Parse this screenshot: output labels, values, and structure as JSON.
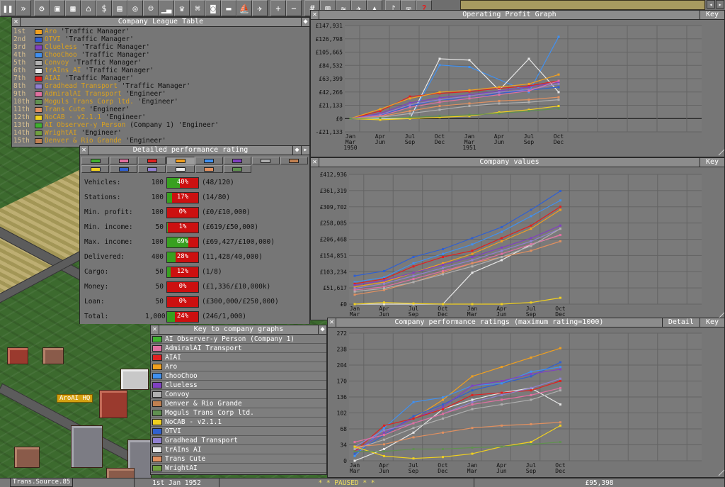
{
  "toolbar": {
    "icons": [
      "pause-icon",
      "fast-forward-icon",
      "settings-wrench-icon",
      "save-disk-icon",
      "map-icon",
      "town-directory-icon",
      "subsidies-icon",
      "stations-icon",
      "finances-coins-icon",
      "company-manager-icon",
      "graphs-icon",
      "league-trophy-icon",
      "industries-icon",
      "trains-icon",
      "road-vehicles-icon",
      "ships-icon",
      "aircraft-icon",
      "zoom-in-icon",
      "zoom-out-icon",
      "build-rail-icon",
      "build-road-icon",
      "build-docks-icon",
      "build-airport-icon",
      "landscaping-icon",
      "music-icon",
      "messages-icon",
      "help-question-icon"
    ]
  },
  "league": {
    "title": "Company League Table",
    "rows": [
      {
        "pos": "1st",
        "name": "Aro",
        "title": "'Traffic Manager'",
        "color": "#f0a020"
      },
      {
        "pos": "2nd",
        "name": "OTVI",
        "title": "'Traffic Manager'",
        "color": "#3060d0"
      },
      {
        "pos": "3rd",
        "name": "Clueless",
        "title": "'Traffic Manager'",
        "color": "#8040c0"
      },
      {
        "pos": "4th",
        "name": "ChooChoo",
        "title": "'Traffic Manager'",
        "color": "#4090f0"
      },
      {
        "pos": "5th",
        "name": "Convoy",
        "title": "'Traffic Manager'",
        "color": "#b0b0b0"
      },
      {
        "pos": "6th",
        "name": "trAIns AI",
        "title": "'Traffic Manager'",
        "color": "#e8e8e8"
      },
      {
        "pos": "7th",
        "name": "AIAI",
        "title": "'Traffic Manager'",
        "color": "#e02020"
      },
      {
        "pos": "8th",
        "name": "Gradhead Transport",
        "title": "'Traffic Manager'",
        "color": "#9080d0"
      },
      {
        "pos": "9th",
        "name": "AdmiralAI Transport",
        "title": "'Engineer'",
        "color": "#e070a0"
      },
      {
        "pos": "10th",
        "name": "Moguls Trans Corp ltd.",
        "title": "'Engineer'",
        "color": "#609050"
      },
      {
        "pos": "11th",
        "name": "Trans Cute",
        "title": "'Engineer'",
        "color": "#e09060"
      },
      {
        "pos": "12th",
        "name": "NoCAB - v2.1.1",
        "title": "'Engineer'",
        "color": "#f0d020"
      },
      {
        "pos": "13th",
        "name": "AI Observer-y Person",
        "extra": "(Company 1)",
        "title": "'Engineer'",
        "color": "#40b030"
      },
      {
        "pos": "14th",
        "name": "WrightAI",
        "title": "'Engineer'",
        "color": "#70a040"
      },
      {
        "pos": "15th",
        "name": "Denver & Rio Grande",
        "title": "'Engineer'",
        "color": "#c08050"
      }
    ]
  },
  "perf": {
    "title": "Detailed performance rating",
    "swatches": [
      "#40b030",
      "#e070a0",
      "#e02020",
      "#f0a020",
      "#4090f0",
      "#8040c0",
      "#b0b0b0",
      "#c08050",
      "#f0d020",
      "#3060d0",
      "#9080d0",
      "#e8e8e8",
      "#e09060",
      "#609050"
    ],
    "rows": [
      {
        "label": "Vehicles:",
        "max": "100",
        "pct": "40%",
        "frac": 0.4,
        "val": "(48/120)"
      },
      {
        "label": "Stations:",
        "max": "100",
        "pct": "17%",
        "frac": 0.17,
        "val": "(14/80)"
      },
      {
        "label": "Min. profit:",
        "max": "100",
        "pct": "0%",
        "frac": 0,
        "val": "(£0/£10,000)"
      },
      {
        "label": "Min. income:",
        "max": "50",
        "pct": "1%",
        "frac": 0.01,
        "val": "(£619/£50,000)"
      },
      {
        "label": "Max. income:",
        "max": "100",
        "pct": "69%",
        "frac": 0.69,
        "val": "(£69,427/£100,000)"
      },
      {
        "label": "Delivered:",
        "max": "400",
        "pct": "28%",
        "frac": 0.28,
        "val": "(11,428/40,000)"
      },
      {
        "label": "Cargo:",
        "max": "50",
        "pct": "12%",
        "frac": 0.12,
        "val": "(1/8)"
      },
      {
        "label": "Money:",
        "max": "50",
        "pct": "0%",
        "frac": 0,
        "val": "(£1,336/£10,000k)"
      },
      {
        "label": "Loan:",
        "max": "50",
        "pct": "0%",
        "frac": 0,
        "val": "(£300,000/£250,000)"
      },
      {
        "label": "Total:",
        "max": "1,000",
        "pct": "24%",
        "frac": 0.24,
        "val": "(246/1,000)"
      }
    ]
  },
  "key": {
    "title": "Key to company graphs",
    "rows": [
      {
        "name": "AI Observer-y Person (Company 1)",
        "color": "#40b030"
      },
      {
        "name": "AdmiralAI Transport",
        "color": "#e070a0"
      },
      {
        "name": "AIAI",
        "color": "#e02020"
      },
      {
        "name": "Aro",
        "color": "#f0a020"
      },
      {
        "name": "ChooChoo",
        "color": "#4090f0"
      },
      {
        "name": "Clueless",
        "color": "#8040c0"
      },
      {
        "name": "Convoy",
        "color": "#b0b0b0"
      },
      {
        "name": "Denver & Rio Grande",
        "color": "#c08050"
      },
      {
        "name": "Moguls Trans Corp ltd.",
        "color": "#609050"
      },
      {
        "name": "NoCAB - v2.1.1",
        "color": "#f0d020"
      },
      {
        "name": "OTVI",
        "color": "#3060d0"
      },
      {
        "name": "Gradhead Transport",
        "color": "#9080d0"
      },
      {
        "name": "trAIns AI",
        "color": "#e8e8e8"
      },
      {
        "name": "Trans Cute",
        "color": "#e09060"
      },
      {
        "name": "WrightAI",
        "color": "#70a040"
      }
    ]
  },
  "graph_titles": {
    "profit": "Operating Profit Graph",
    "values": "Company values",
    "ratings": "Company performance ratings (maximum rating=1000)",
    "key_btn": "Key",
    "detail_btn": "Detail"
  },
  "chart_data": [
    {
      "type": "line",
      "title": "Operating Profit Graph",
      "x": [
        "Jan 1950",
        "Mar",
        "Apr",
        "Jun",
        "Jul",
        "Sep",
        "Oct",
        "Dec",
        "Jan 1951",
        "Mar",
        "Apr",
        "Jun",
        "Jul",
        "Sep",
        "Oct",
        "Dec"
      ],
      "xticks": [
        [
          "Jan",
          "Mar"
        ],
        [
          "Apr",
          "Jun"
        ],
        [
          "Jul",
          "Sep"
        ],
        [
          "Oct",
          "Dec"
        ],
        [
          "Jan",
          "Mar"
        ],
        [
          "Apr",
          "Jun"
        ],
        [
          "Jul",
          "Sep"
        ],
        [
          "Oct",
          "Dec"
        ]
      ],
      "years": [
        "1950",
        "1951"
      ],
      "yticks": [
        "£147,931",
        "£126,798",
        "£105,665",
        "£84,532",
        "£63,399",
        "£42,266",
        "£21,133",
        "£0",
        "-£21,133"
      ],
      "ylim": [
        -21133,
        147931
      ],
      "series": [
        {
          "name": "ChooChoo",
          "color": "#4090f0",
          "values": [
            0,
            0,
            0,
            85000,
            82000,
            null,
            42000,
            130000
          ]
        },
        {
          "name": "trAIns AI",
          "color": "#e8e8e8",
          "values": [
            0,
            0,
            0,
            95000,
            93000,
            45000,
            95000,
            42000
          ]
        },
        {
          "name": "AIAI",
          "color": "#e02020",
          "values": [
            0,
            12000,
            35000,
            40000,
            43000,
            48000,
            52000,
            60000
          ]
        },
        {
          "name": "Aro",
          "color": "#f0a020",
          "values": [
            0,
            15000,
            32000,
            42000,
            45000,
            50000,
            55000,
            70000
          ]
        },
        {
          "name": "OTVI",
          "color": "#3060d0",
          "values": [
            0,
            5000,
            20000,
            30000,
            32000,
            40000,
            45000,
            50000
          ]
        },
        {
          "name": "Clueless",
          "color": "#8040c0",
          "values": [
            0,
            8000,
            25000,
            33000,
            38000,
            44000,
            50000,
            58000
          ]
        },
        {
          "name": "Gradhead Transport",
          "color": "#9080d0",
          "values": [
            0,
            6000,
            22000,
            30000,
            36000,
            42000,
            46000,
            55000
          ]
        },
        {
          "name": "AdmiralAI Transport",
          "color": "#e070a0",
          "values": [
            0,
            4000,
            18000,
            26000,
            32000,
            38000,
            44000,
            60000
          ]
        },
        {
          "name": "Trans Cute",
          "color": "#e09060",
          "values": [
            0,
            3000,
            12000,
            20000,
            24000,
            28000,
            30000,
            34000
          ]
        },
        {
          "name": "NoCAB - v2.1.1",
          "color": "#f0d020",
          "values": [
            0,
            -2000,
            0,
            2000,
            4000,
            10000,
            14000,
            20000
          ]
        },
        {
          "name": "Convoy",
          "color": "#b0b0b0",
          "values": [
            0,
            2000,
            8000,
            14000,
            20000,
            24000,
            26000,
            30000
          ]
        },
        {
          "name": "Moguls Trans Corp ltd.",
          "color": "#609050",
          "values": [
            0,
            1000,
            2000,
            4000,
            6000,
            8000,
            12000,
            16000
          ]
        }
      ]
    },
    {
      "type": "line",
      "title": "Company values",
      "xticks": [
        [
          "Jan",
          "Mar"
        ],
        [
          "Apr",
          "Jun"
        ],
        [
          "Jul",
          "Sep"
        ],
        [
          "Oct",
          "Dec"
        ],
        [
          "Jan",
          "Mar"
        ],
        [
          "Apr",
          "Jun"
        ],
        [
          "Jul",
          "Sep"
        ],
        [
          "Oct",
          "Dec"
        ]
      ],
      "yticks": [
        "£412,936",
        "£361,319",
        "£309,702",
        "£258,085",
        "£206,468",
        "£154,851",
        "£103,234",
        "£51,617",
        "£0"
      ],
      "ylim": [
        0,
        412936
      ],
      "series": [
        {
          "name": "OTVI",
          "color": "#3060d0",
          "values": [
            90000,
            105000,
            150000,
            175000,
            210000,
            245000,
            300000,
            360000
          ]
        },
        {
          "name": "ChooChoo",
          "color": "#4090f0",
          "values": [
            70000,
            85000,
            130000,
            160000,
            190000,
            230000,
            280000,
            330000
          ]
        },
        {
          "name": "AIAI",
          "color": "#e02020",
          "values": [
            65000,
            80000,
            120000,
            150000,
            170000,
            210000,
            250000,
            310000
          ]
        },
        {
          "name": "Aro",
          "color": "#f0a020",
          "values": [
            55000,
            70000,
            100000,
            130000,
            160000,
            200000,
            240000,
            300000
          ]
        },
        {
          "name": "trAIns AI",
          "color": "#e8e8e8",
          "values": [
            0,
            0,
            0,
            0,
            100000,
            140000,
            190000,
            220000
          ]
        },
        {
          "name": "Clueless",
          "color": "#8040c0",
          "values": [
            60000,
            75000,
            100000,
            125000,
            150000,
            180000,
            210000,
            250000
          ]
        },
        {
          "name": "Gradhead Transport",
          "color": "#9080d0",
          "values": [
            50000,
            65000,
            90000,
            115000,
            140000,
            170000,
            200000,
            240000
          ]
        },
        {
          "name": "AdmiralAI Transport",
          "color": "#e070a0",
          "values": [
            45000,
            55000,
            80000,
            105000,
            130000,
            160000,
            190000,
            220000
          ]
        },
        {
          "name": "Trans Cute",
          "color": "#e09060",
          "values": [
            30000,
            45000,
            70000,
            100000,
            130000,
            150000,
            170000,
            200000
          ]
        },
        {
          "name": "Convoy",
          "color": "#b0b0b0",
          "values": [
            40000,
            50000,
            70000,
            95000,
            120000,
            150000,
            185000,
            240000
          ]
        },
        {
          "name": "NoCAB - v2.1.1",
          "color": "#f0d020",
          "values": [
            0,
            5000,
            2000,
            0,
            0,
            0,
            5000,
            20000
          ]
        }
      ]
    },
    {
      "type": "line",
      "title": "Company performance ratings (maximum rating=1000)",
      "xticks": [
        [
          "Jan",
          "Mar"
        ],
        [
          "Apr",
          "Jun"
        ],
        [
          "Jul",
          "Sep"
        ],
        [
          "Oct",
          "Dec"
        ],
        [
          "Jan",
          "Mar"
        ],
        [
          "Apr",
          "Jun"
        ],
        [
          "Jul",
          "Sep"
        ],
        [
          "Oct",
          "Dec"
        ]
      ],
      "yticks": [
        "272",
        "238",
        "204",
        "170",
        "136",
        "102",
        "68",
        "34",
        "0"
      ],
      "ylim": [
        0,
        272
      ],
      "series": [
        {
          "name": "Aro",
          "color": "#f0a020",
          "values": [
            20,
            60,
            90,
            130,
            180,
            200,
            220,
            240
          ]
        },
        {
          "name": "OTVI",
          "color": "#3060d0",
          "values": [
            15,
            55,
            95,
            120,
            150,
            165,
            180,
            210
          ]
        },
        {
          "name": "ChooChoo",
          "color": "#4090f0",
          "values": [
            10,
            70,
            125,
            135,
            160,
            165,
            190,
            200
          ]
        },
        {
          "name": "Clueless",
          "color": "#8040c0",
          "values": [
            20,
            60,
            90,
            115,
            160,
            170,
            185,
            195
          ]
        },
        {
          "name": "trAIns AI",
          "color": "#e8e8e8",
          "values": [
            0,
            25,
            60,
            110,
            130,
            145,
            155,
            120
          ]
        },
        {
          "name": "AIAI",
          "color": "#e02020",
          "values": [
            20,
            75,
            90,
            110,
            140,
            145,
            150,
            170
          ]
        },
        {
          "name": "Gradhead Transport",
          "color": "#9080d0",
          "values": [
            30,
            65,
            80,
            100,
            125,
            140,
            155,
            175
          ]
        },
        {
          "name": "AdmiralAI Transport",
          "color": "#e070a0",
          "values": [
            40,
            55,
            80,
            100,
            120,
            130,
            140,
            155
          ]
        },
        {
          "name": "Convoy",
          "color": "#b0b0b0",
          "values": [
            25,
            45,
            70,
            90,
            110,
            120,
            130,
            150
          ]
        },
        {
          "name": "Trans Cute",
          "color": "#e09060",
          "values": [
            30,
            35,
            50,
            60,
            70,
            75,
            78,
            82
          ]
        },
        {
          "name": "NoCAB - v2.1.1",
          "color": "#f0d020",
          "values": [
            30,
            10,
            5,
            8,
            15,
            30,
            40,
            75
          ]
        },
        {
          "name": "Moguls Trans Corp ltd.",
          "color": "#609050",
          "values": [
            20,
            20,
            25,
            25,
            28,
            30,
            35,
            40
          ]
        }
      ]
    }
  ],
  "map": {
    "sign": "AroAI HQ",
    "news": "Trans.Source.85"
  },
  "status": {
    "date": "1st Jan 1952",
    "paused": "*  *  PAUSED  *  *",
    "money": "£95,398"
  }
}
